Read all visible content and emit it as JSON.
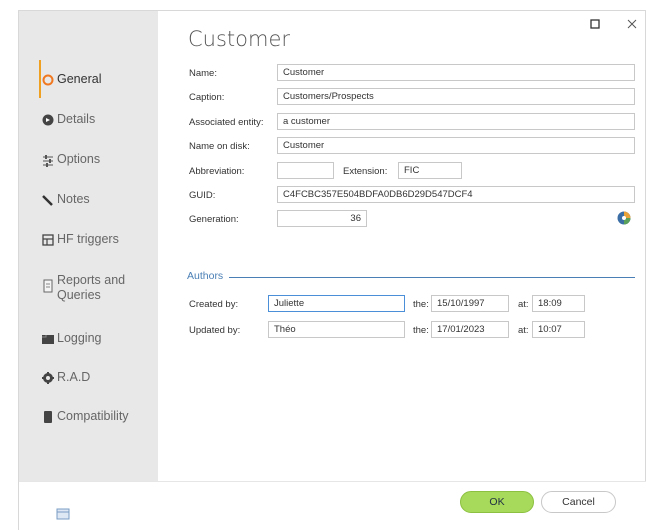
{
  "window": {
    "title": "Customer",
    "maximize_icon": "maximize-icon",
    "close_icon": "close-icon"
  },
  "sidebar": {
    "items": [
      {
        "label": "General",
        "icon": "general-icon",
        "active": true
      },
      {
        "label": "Details",
        "icon": "details-icon"
      },
      {
        "label": "Options",
        "icon": "options-icon"
      },
      {
        "label": "Notes",
        "icon": "notes-icon"
      },
      {
        "label": "HF triggers",
        "icon": "triggers-icon"
      },
      {
        "label": "Reports and Queries",
        "icon": "reports-icon"
      },
      {
        "label": "Logging",
        "icon": "logging-icon"
      },
      {
        "label": "R.A.D",
        "icon": "rad-icon"
      },
      {
        "label": "Compatibility",
        "icon": "compatibility-icon"
      }
    ]
  },
  "form": {
    "name_label": "Name:",
    "name_value": "Customer",
    "caption_label": "Caption:",
    "caption_value": "Customers/Prospects",
    "entity_label": "Associated entity:",
    "entity_value": "a customer",
    "disk_label": "Name on disk:",
    "disk_value": "Customer",
    "abbrev_label": "Abbreviation:",
    "abbrev_value": "",
    "ext_label": "Extension:",
    "ext_value": "FIC",
    "guid_label": "GUID:",
    "guid_value": "C4FCBC357E504BDFA0DB6D29D547DCF4",
    "gen_label": "Generation:",
    "gen_value": "36"
  },
  "authors": {
    "section_title": "Authors",
    "created_label": "Created by:",
    "created_by": "Juliette",
    "created_the_label": "the:",
    "created_date": "15/10/1997",
    "created_at_label": "at:",
    "created_time": "18:09",
    "updated_label": "Updated by:",
    "updated_by": "Théo",
    "updated_the_label": "the:",
    "updated_date": "17/01/2023",
    "updated_at_label": "at:",
    "updated_time": "10:07"
  },
  "footer": {
    "ok_label": "OK",
    "cancel_label": "Cancel"
  },
  "colors": {
    "accent": "#f0a020",
    "section": "#4a7fb5",
    "ok_button": "#a7d95a"
  }
}
